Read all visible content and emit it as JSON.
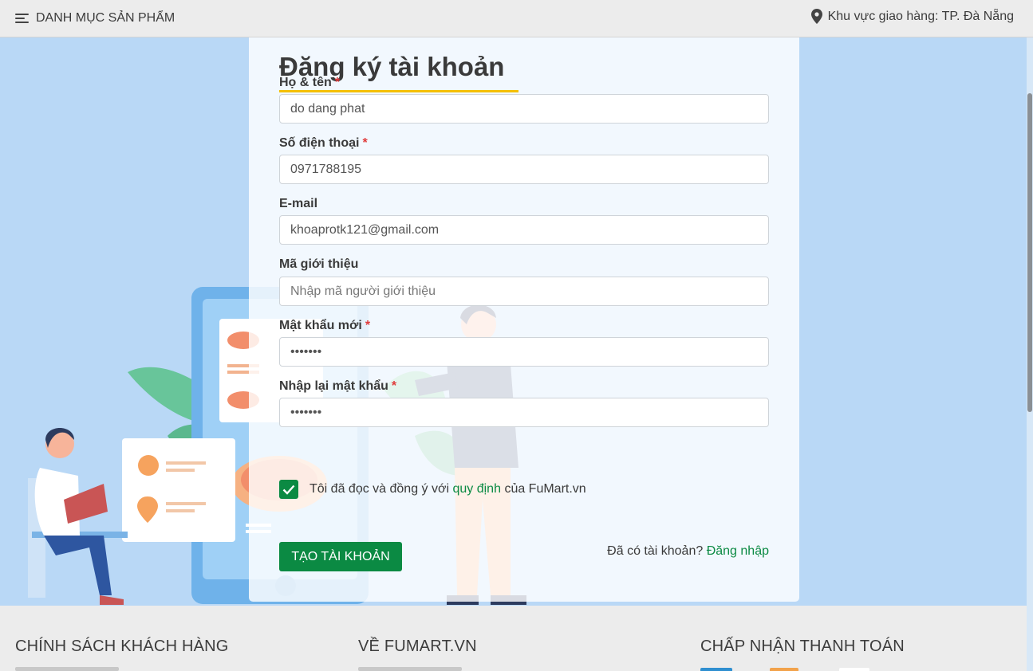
{
  "topbar": {
    "menu_label": "DANH MỤC SẢN PHẨM",
    "region_label": "Khu vực giao hàng: TP. Đà Nẵng"
  },
  "form": {
    "title": "Đăng ký tài khoản",
    "fields": {
      "name": {
        "label": "Họ & tên",
        "required": "*",
        "value": "do dang phat",
        "placeholder": ""
      },
      "phone": {
        "label": "Số điện thoại",
        "required": "*",
        "value": "0971788195",
        "placeholder": ""
      },
      "email": {
        "label": "E-mail",
        "value": "khoaprotk121@gmail.com",
        "placeholder": ""
      },
      "referral": {
        "label": "Mã giới thiệu",
        "value": "",
        "placeholder": "Nhập mã người giới thiệu"
      },
      "password": {
        "label": "Mật khẩu mới",
        "required": "*",
        "value": "•••••••"
      },
      "confirm": {
        "label": "Nhập lại mật khẩu",
        "required": "*",
        "value": "•••••••"
      }
    },
    "agree": {
      "prefix": "Tôi đã đọc và đồng ý với",
      "link": "quy định",
      "suffix": "của FuMart.vn",
      "checked": true
    },
    "submit_label": "TẠO TÀI KHOẢN",
    "login_prompt": "Đã có tài khoản?",
    "login_link": "Đăng nhập"
  },
  "footer": {
    "col1_title": "CHÍNH SÁCH KHÁCH HÀNG",
    "col2_title": "VỀ FUMART.VN",
    "col3_title": "CHẤP NHẬN THANH TOÁN"
  },
  "colors": {
    "accent_green": "#0b8a43",
    "title_underline": "#f5c000",
    "required": "#e03b3b",
    "hero_bg": "#b9d8f6"
  },
  "icons": [
    "hamburger-icon",
    "map-pin-icon",
    "checkmark-icon"
  ]
}
